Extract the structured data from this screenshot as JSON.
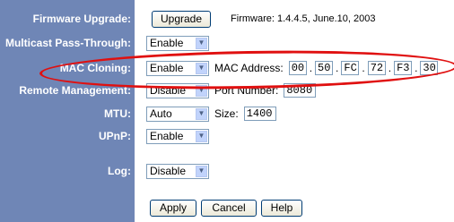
{
  "firmware": {
    "label": "Firmware Upgrade:",
    "button": "Upgrade",
    "info": "Firmware: 1.4.4.5, June.10, 2003"
  },
  "multicast": {
    "label": "Multicast Pass-Through:",
    "value": "Enable"
  },
  "mac_cloning": {
    "label": "MAC Cloning:",
    "value": "Enable",
    "address_label": "MAC Address:",
    "octets": [
      "00",
      "50",
      "FC",
      "72",
      "F3",
      "30"
    ],
    "separator": "."
  },
  "remote": {
    "label": "Remote Management:",
    "value": "Disable",
    "port_label": "Port Number:",
    "port": "8080"
  },
  "mtu": {
    "label": "MTU:",
    "value": "Auto",
    "size_label": "Size:",
    "size": "1400"
  },
  "upnp": {
    "label": "UPnP:",
    "value": "Enable"
  },
  "log": {
    "label": "Log:",
    "value": "Disable"
  },
  "actions": {
    "apply": "Apply",
    "cancel": "Cancel",
    "help": "Help"
  },
  "icons": {
    "dropdown": "chevron-down-icon"
  },
  "colors": {
    "label_background": "#6f86b6",
    "highlight": "#e01010"
  }
}
